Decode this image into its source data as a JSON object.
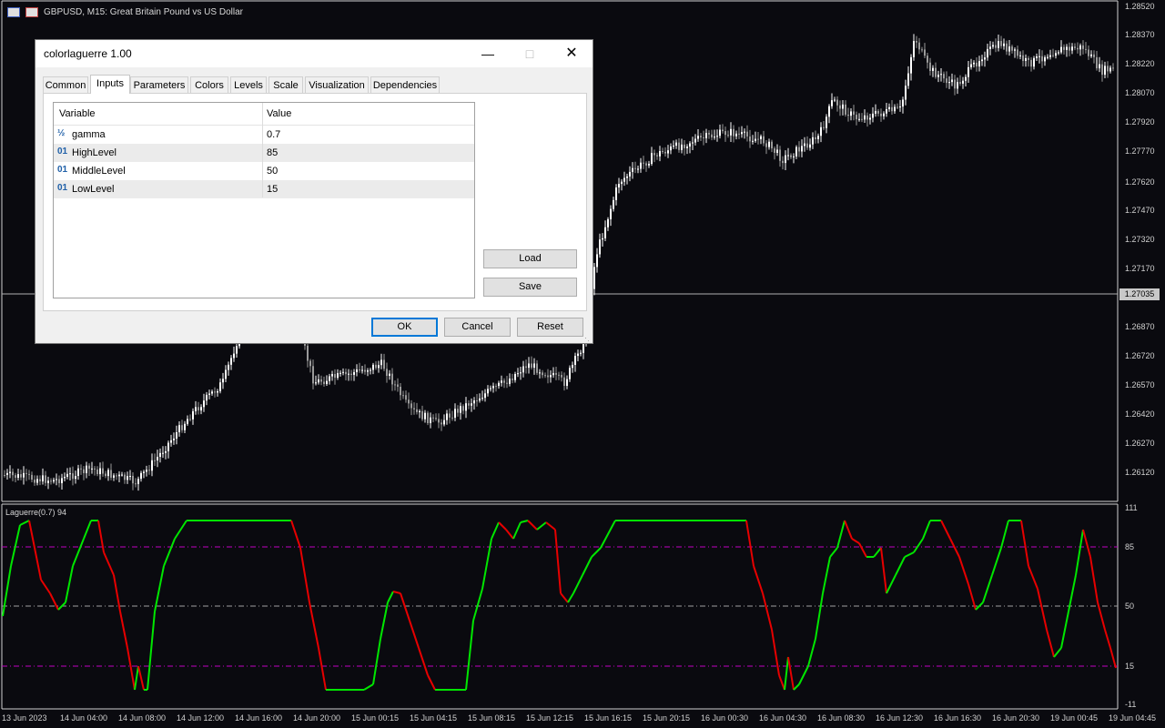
{
  "chart": {
    "title": "GBPUSD, M15:  Great Britain Pound vs US Dollar",
    "price_axis": [
      "1.28520",
      "1.28370",
      "1.28220",
      "1.28070",
      "1.27920",
      "1.27770",
      "1.27620",
      "1.27470",
      "1.27320",
      "1.27170",
      "1.26870",
      "1.26720",
      "1.26570",
      "1.26420",
      "1.26270",
      "1.26120"
    ],
    "current_price": "1.27035",
    "bull_color": "#ffffff",
    "bear_color": "#9a9a9a"
  },
  "indicator": {
    "title": "Laguerre(0.7) 94",
    "axis": [
      "111",
      "85",
      "50",
      "15",
      "-11"
    ],
    "up_color": "#00e600",
    "down_color": "#e60000",
    "level_color": "#c000c0",
    "levels": [
      85,
      50,
      15
    ]
  },
  "time_axis": [
    "13 Jun 2023",
    "14 Jun 04:00",
    "14 Jun 08:00",
    "14 Jun 12:00",
    "14 Jun 16:00",
    "14 Jun 20:00",
    "15 Jun 00:15",
    "15 Jun 04:15",
    "15 Jun 08:15",
    "15 Jun 12:15",
    "15 Jun 16:15",
    "15 Jun 20:15",
    "16 Jun 00:30",
    "16 Jun 04:30",
    "16 Jun 08:30",
    "16 Jun 12:30",
    "16 Jun 16:30",
    "16 Jun 20:30",
    "19 Jun 00:45",
    "19 Jun 04:45"
  ],
  "dialog": {
    "title": "colorlaguerre 1.00",
    "tabs": [
      "Common",
      "Inputs",
      "Parameters",
      "Colors",
      "Levels",
      "Scale",
      "Visualization",
      "Dependencies"
    ],
    "active_tab": "Inputs",
    "columns": {
      "variable": "Variable",
      "value": "Value"
    },
    "rows": [
      {
        "icon": "½",
        "name": "gamma",
        "value": "0.7"
      },
      {
        "icon": "01",
        "name": "HighLevel",
        "value": "85"
      },
      {
        "icon": "01",
        "name": "MiddleLevel",
        "value": "50"
      },
      {
        "icon": "01",
        "name": "LowLevel",
        "value": "15"
      }
    ],
    "load_label": "Load",
    "save_label": "Save",
    "ok_label": "OK",
    "cancel_label": "Cancel",
    "reset_label": "Reset"
  }
}
